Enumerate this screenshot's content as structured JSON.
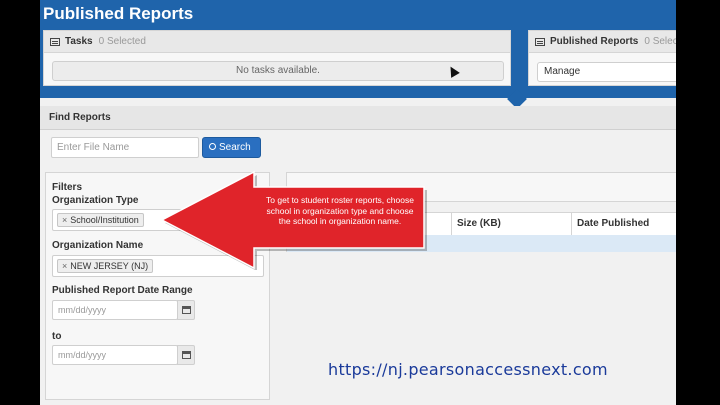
{
  "header": {
    "title": "Published Reports"
  },
  "tasks": {
    "title": "Tasks",
    "selected": "0 Selected",
    "empty_message": "No tasks available."
  },
  "published": {
    "title": "Published Reports",
    "selected": "0 Selec",
    "select_value": "Manage"
  },
  "find_reports": {
    "title": "Find Reports",
    "file_name_placeholder": "Enter File Name",
    "search_label": "Search"
  },
  "filters": {
    "title": "Filters",
    "org_type_label": "Organization Type",
    "org_type_value": "School/Institution",
    "org_name_label": "Organization Name",
    "org_name_value": "NEW JERSEY (NJ)",
    "date_range_label": "Published Report Date Range",
    "from_placeholder": "mm/dd/yyyy",
    "to_label": "to",
    "to_placeholder": "mm/dd/yyyy"
  },
  "results": {
    "columns": [
      "Size (KB)",
      "Date Published"
    ]
  },
  "callout": {
    "text": "To get to student roster reports, choose school in organization type and choose the school in organization name.",
    "color": "#e0242a"
  },
  "footer": {
    "url": "https://nj.pearsonaccessnext.com"
  },
  "colors": {
    "header_blue": "#1f64ab",
    "button_blue": "#2a6fc0",
    "row_highlight": "#dbe9f6"
  }
}
